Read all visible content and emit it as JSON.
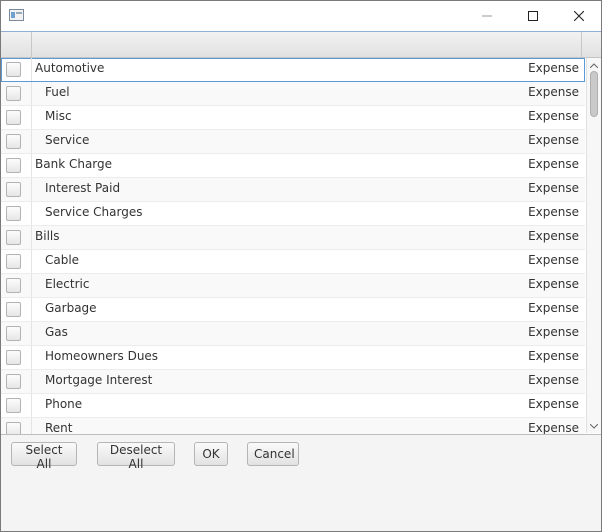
{
  "window": {
    "title": ""
  },
  "table": {
    "rows": [
      {
        "name": "Automotive",
        "type": "Expense",
        "indent": 0,
        "checked": false
      },
      {
        "name": "Fuel",
        "type": "Expense",
        "indent": 1,
        "checked": false
      },
      {
        "name": "Misc",
        "type": "Expense",
        "indent": 1,
        "checked": false
      },
      {
        "name": "Service",
        "type": "Expense",
        "indent": 1,
        "checked": false
      },
      {
        "name": "Bank Charge",
        "type": "Expense",
        "indent": 0,
        "checked": false
      },
      {
        "name": "Interest Paid",
        "type": "Expense",
        "indent": 1,
        "checked": false
      },
      {
        "name": "Service Charges",
        "type": "Expense",
        "indent": 1,
        "checked": false
      },
      {
        "name": "Bills",
        "type": "Expense",
        "indent": 0,
        "checked": false
      },
      {
        "name": "Cable",
        "type": "Expense",
        "indent": 1,
        "checked": false
      },
      {
        "name": "Electric",
        "type": "Expense",
        "indent": 1,
        "checked": false
      },
      {
        "name": "Garbage",
        "type": "Expense",
        "indent": 1,
        "checked": false
      },
      {
        "name": "Gas",
        "type": "Expense",
        "indent": 1,
        "checked": false
      },
      {
        "name": "Homeowners Dues",
        "type": "Expense",
        "indent": 1,
        "checked": false
      },
      {
        "name": "Mortgage Interest",
        "type": "Expense",
        "indent": 1,
        "checked": false
      },
      {
        "name": "Phone",
        "type": "Expense",
        "indent": 1,
        "checked": false
      },
      {
        "name": "Rent",
        "type": "Expense",
        "indent": 1,
        "checked": false
      }
    ]
  },
  "buttons": {
    "select_all": "Select All",
    "deselect_all": "Deselect All",
    "ok": "OK",
    "cancel": "Cancel"
  },
  "icons": {
    "app": "window-app-icon",
    "minimize": "minimize-icon",
    "maximize": "maximize-icon",
    "close": "close-icon"
  },
  "colors": {
    "focus": "#5b9bd5",
    "header_border": "#8fb0d4"
  }
}
